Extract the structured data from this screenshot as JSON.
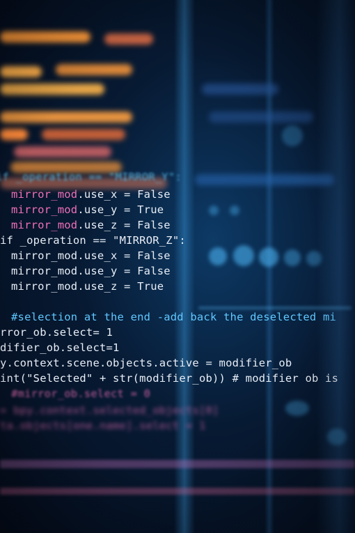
{
  "code_lines": [
    {
      "id": "l1",
      "text": "if _operation == \"MIRROR_Y\":"
    },
    {
      "id": "l2",
      "parts": [
        "mirror_mod",
        ".use_x = ",
        "False"
      ]
    },
    {
      "id": "l3",
      "parts": [
        "mirror_mod",
        ".use_y = ",
        "True"
      ]
    },
    {
      "id": "l4",
      "parts": [
        "mirror_mod",
        ".use_z = ",
        "False"
      ]
    },
    {
      "id": "l5",
      "text": "if _operation == \"MIRROR_Z\":"
    },
    {
      "id": "l6",
      "parts": [
        "mirror_mod",
        ".use_x = ",
        "False"
      ]
    },
    {
      "id": "l7",
      "parts": [
        "mirror_mod",
        ".use_y = ",
        "False"
      ]
    },
    {
      "id": "l8",
      "parts": [
        "mirror_mod",
        ".use_z = ",
        "True"
      ]
    },
    {
      "id": "l9",
      "text": "#selection at the end -add back the deselected mi"
    },
    {
      "id": "l10",
      "text": "rror_ob.select= 1"
    },
    {
      "id": "l11",
      "text": "difier_ob.select=1"
    },
    {
      "id": "l12",
      "text": "y.context.scene.objects.active = modifier_ob"
    },
    {
      "id": "l13",
      "text": "int(\"Selected\" + str(modifier_ob)) # modifier ob is"
    },
    {
      "id": "l14",
      "text": "#mirror_ob.select = 0"
    },
    {
      "id": "l15",
      "text": "= bpy.context.selected_objects[0]"
    },
    {
      "id": "l16",
      "text": "ta.objects[one.name].select = 1"
    }
  ],
  "colors": {
    "keyword": "#5fd0ff",
    "object": "#f070b8",
    "text": "#e8eef7",
    "background": "#071a33"
  }
}
